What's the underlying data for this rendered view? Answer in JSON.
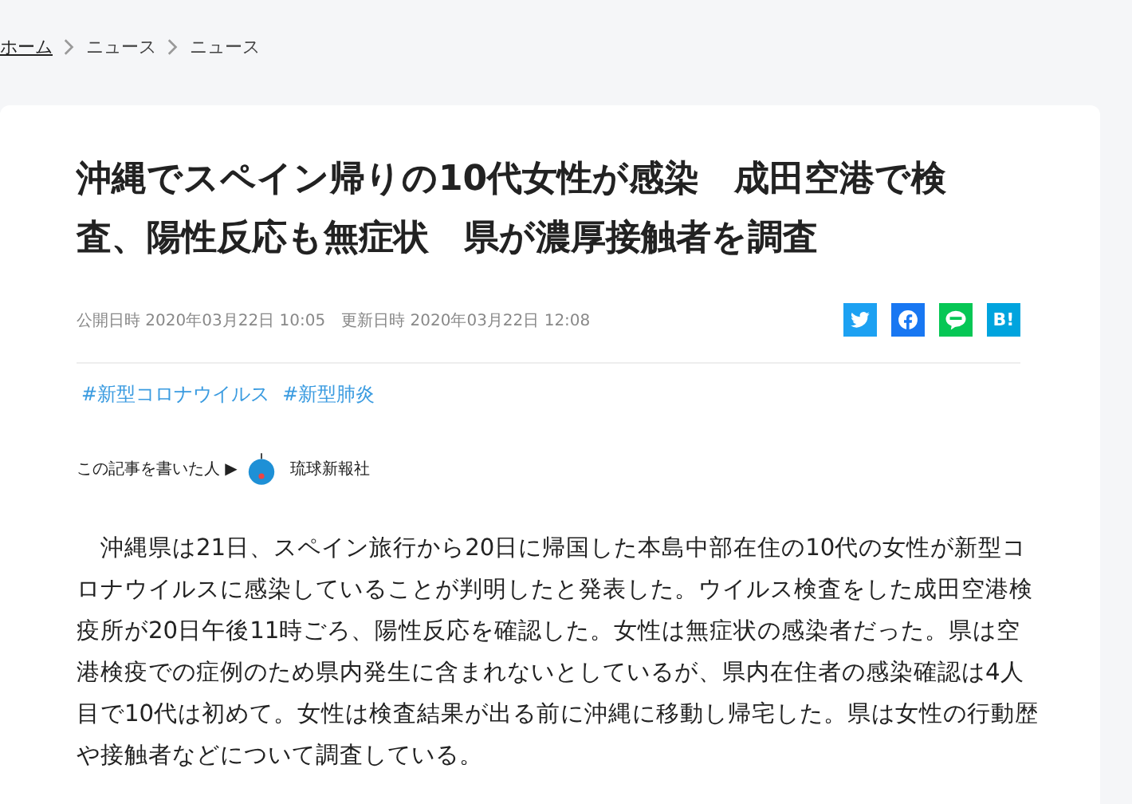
{
  "breadcrumb": [
    {
      "label": "ホーム",
      "link": true
    },
    {
      "label": "ニュース",
      "link": false
    },
    {
      "label": "ニュース",
      "link": false
    }
  ],
  "article": {
    "title": "沖縄でスペイン帰りの10代女性が感染　成田空港で検査、陽性反応も無症状　県が濃厚接触者を調査",
    "published": "公開日時 2020年03月22日 10:05",
    "updated": "更新日時 2020年03月22日 12:08",
    "share": [
      {
        "kind": "twitter",
        "color": "#1da1f2"
      },
      {
        "kind": "facebook",
        "color": "#1877f2"
      },
      {
        "kind": "line",
        "color": "#06c755"
      },
      {
        "kind": "hatena",
        "color": "#00a4de",
        "label": "B!"
      }
    ],
    "tags": [
      "#新型コロナウイルス",
      "#新型肺炎"
    ],
    "author_label": "この記事を書いた人 ▶",
    "author": "琉球新報社",
    "body": "　沖縄県は21日、スペイン旅行から20日に帰国した本島中部在住の10代の女性が新型コロナウイルスに感染していることが判明したと発表した。ウイルス検査をした成田空港検疫所が20日午後11時ごろ、陽性反応を確認した。女性は無症状の感染者だった。県は空港検疫での症例のため県内発生に含まれないとしているが、県内在住者の感染確認は4人目で10代は初めて。女性は検査結果が出る前に沖縄に移動し帰宅した。県は女性の行動歴や接触者などについて調査している。"
  }
}
